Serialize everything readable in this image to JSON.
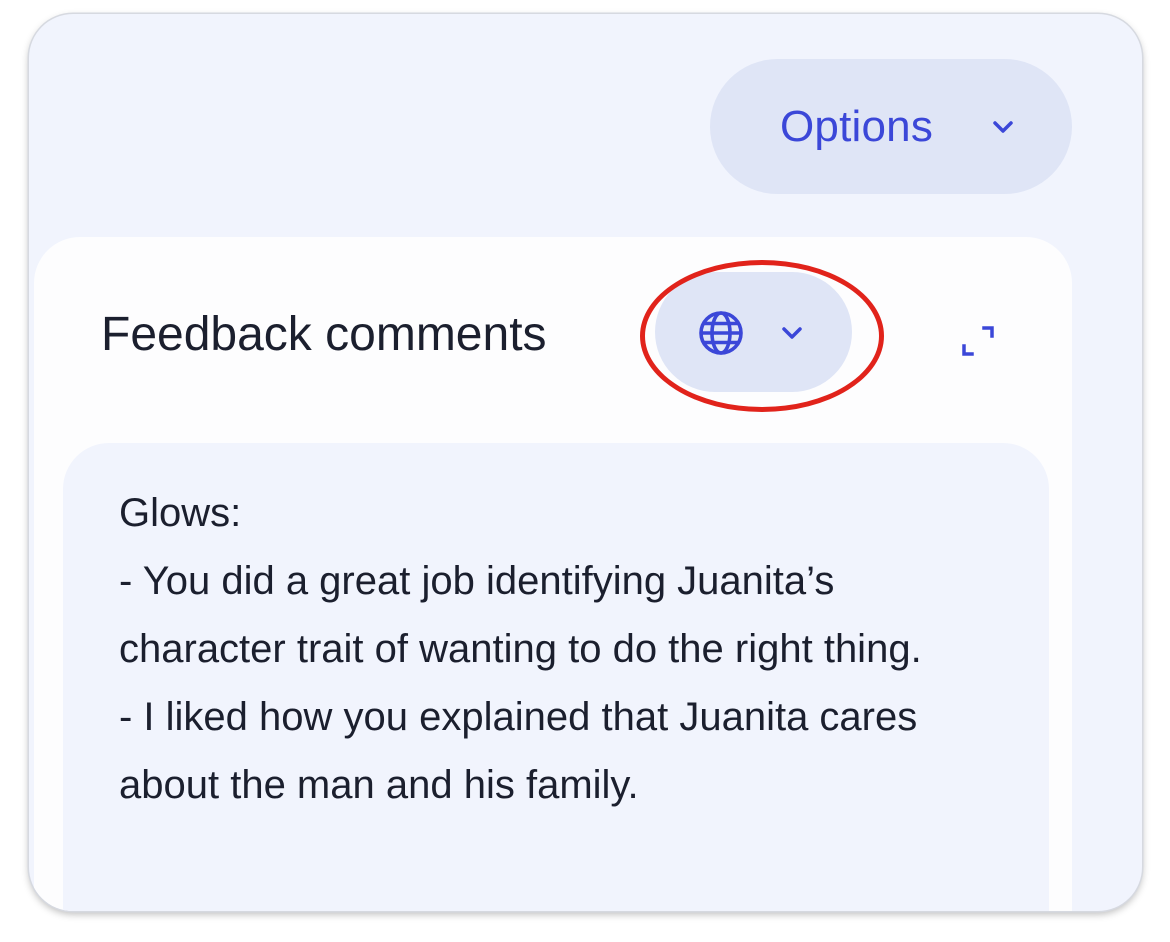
{
  "options": {
    "label": "Options",
    "icon": "chevron-down-icon"
  },
  "feedback": {
    "title": "Feedback comments",
    "language_icon": "globe-icon",
    "language_chevron": "chevron-down-icon",
    "expand_icon": "expand-icon",
    "comment": "Glows:\n- You did a great job identifying Juanita’s character trait of wanting to do the right thing.\n- I liked how you explained that Juanita cares about the man and his family."
  },
  "colors": {
    "accent": "#3b47d8",
    "pill_background": "#dfe5f6",
    "panel_background": "#f1f4fd",
    "highlight": "#e1231b"
  }
}
